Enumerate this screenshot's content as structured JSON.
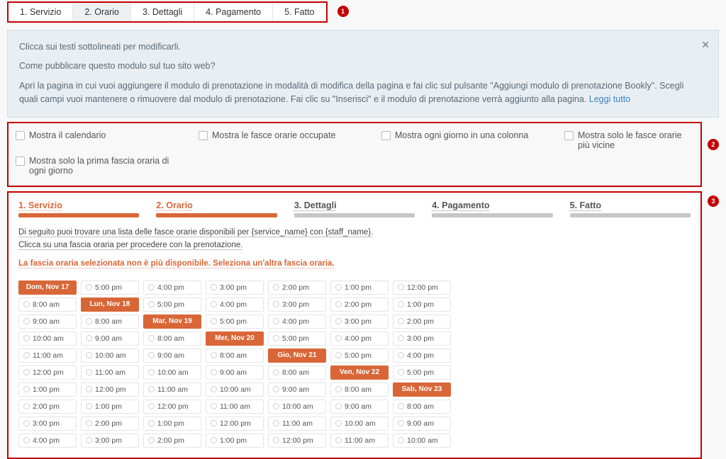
{
  "tabs": {
    "t1": "1. Servizio",
    "t2": "2. Orario",
    "t3": "3. Dettagli",
    "t4": "4. Pagamento",
    "t5": "5. Fatto"
  },
  "markers": {
    "m1": "1",
    "m2": "2",
    "m3": "3"
  },
  "alert": {
    "line1": "Clicca sui testi sottolineati per modificarli.",
    "line2": "Come pubblicare questo modulo sul tuo sito web?",
    "line3a": "Apri la pagina in cui vuoi aggiungere il modulo di prenotazione in modalità di modifica della pagina e fai clic sul pulsante \"Aggiungi modulo di prenotazione Bookly\". Scegli quali campi vuoi mantenere o rimuovere dal modulo di prenotazione. Fai clic su \"Inserisci\" e il modulo di prenotazione verrà aggiunto alla pagina. ",
    "readmore": "Leggi tutto",
    "close": "✕"
  },
  "opts": {
    "o1": "Mostra il calendario",
    "o2": "Mostra le fasce orarie occupate",
    "o3": "Mostra ogni giorno in una colonna",
    "o4": "Mostra solo le fasce orarie più vicine",
    "o5": "Mostra solo la prima fascia oraria di ogni giorno"
  },
  "stepper": {
    "s1": "1. Servizio",
    "s2": "2. Orario",
    "s3": "3. Dettagli",
    "s4": "4. Pagamento",
    "s5": "5. Fatto"
  },
  "helper": {
    "h1": "Di seguito puoi trovare una lista delle fasce orarie disponibili per {service_name} con {staff_name}.",
    "h2": "Clicca su una fascia oraria per procedere con la prenotazione.",
    "h3": "La fascia oraria selezionata non è più disponibile. Seleziona un'altra fascia oraria."
  },
  "days": {
    "d0": "Dom, Nov 17",
    "d1": "Lun, Nov 18",
    "d2": "Mar, Nov 19",
    "d3": "Mer, Nov 20",
    "d4": "Gio, Nov 21",
    "d5": "Ven, Nov 22",
    "d6": "Sab, Nov 23"
  },
  "times": {
    "t0800": "8:00 am",
    "t0900": "9:00 am",
    "t1000": "10:00 am",
    "t1100": "11:00 am",
    "t1200": "12:00 pm",
    "t1300": "1:00 pm",
    "t1400": "2:00 pm",
    "t1500": "3:00 pm",
    "t1600": "4:00 pm",
    "t1700": "5:00 pm"
  }
}
